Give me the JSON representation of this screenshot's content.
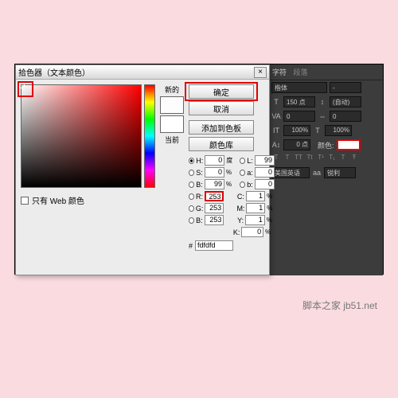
{
  "watermark": "脚本之家 jb51.net",
  "dialog": {
    "title": "拾色器（文本颜色）",
    "close": "×",
    "new_label": "新的",
    "current_label": "当前",
    "btn_ok": "确定",
    "btn_cancel": "取消",
    "btn_add": "添加到色板",
    "btn_lib": "颜色库",
    "web_only": "只有 Web 颜色",
    "hex_label": "#",
    "hex_value": "fdfdfd",
    "new_color": "#fdfdfd",
    "current_color": "#ffffff",
    "hsb": {
      "H": {
        "v": "0",
        "u": "度"
      },
      "S": {
        "v": "0",
        "u": "%"
      },
      "B": {
        "v": "99",
        "u": "%"
      }
    },
    "rgb": {
      "R": {
        "v": "253",
        "u": ""
      },
      "G": {
        "v": "253",
        "u": ""
      },
      "B": {
        "v": "253",
        "u": ""
      }
    },
    "lab": {
      "L": {
        "v": "99",
        "u": ""
      },
      "a": {
        "v": "0",
        "u": ""
      },
      "b": {
        "v": "0",
        "u": ""
      }
    },
    "cmyk": {
      "C": {
        "v": "1",
        "u": "%"
      },
      "M": {
        "v": "1",
        "u": "%"
      },
      "Y": {
        "v": "1",
        "u": "%"
      },
      "K": {
        "v": "0",
        "u": "%"
      }
    }
  },
  "panel": {
    "tab1": "字符",
    "tab2": "段落",
    "font": "楷体",
    "style": "-",
    "size": "150 点",
    "leading": "(自动)",
    "va_metric": "VA",
    "va_val": "0",
    "tracking": "0",
    "scale_v": "100%",
    "scale_h": "100%",
    "baseline_lbl": "A↕",
    "baseline": "0 点",
    "color_lbl": "颜色:",
    "lang": "美国英语",
    "aa": "锐利",
    "aa_lbl": "aa"
  }
}
